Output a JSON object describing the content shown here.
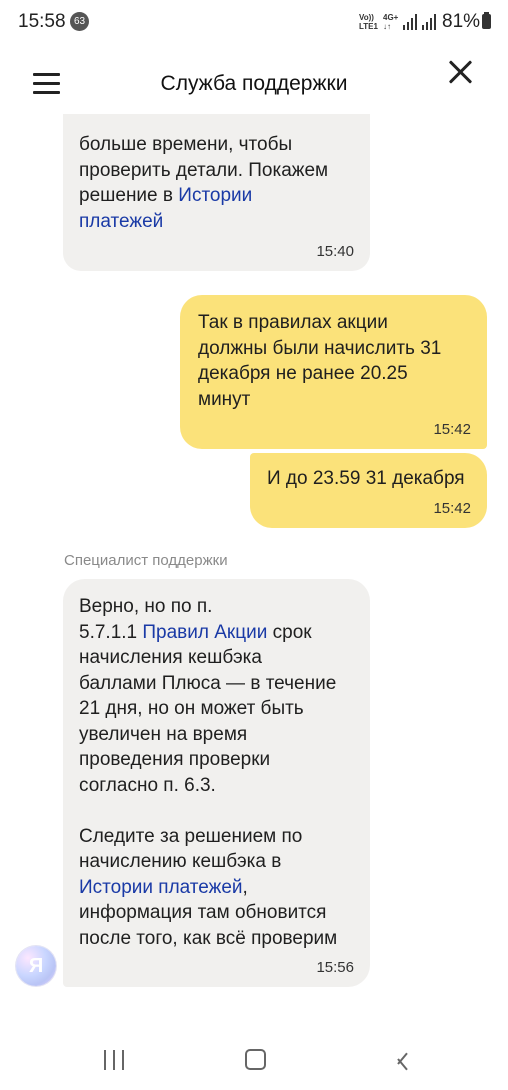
{
  "status_bar": {
    "time": "15:58",
    "notification_count": "63",
    "volte": "Vo))\nLTE1",
    "network": "4G+\n↓↑",
    "battery": "81%"
  },
  "header": {
    "title": "Служба поддержки",
    "menu_icon": "hamburger-menu-icon",
    "close_icon": "close-icon"
  },
  "messages": [
    {
      "author": "agent",
      "text_before": "больше времени, чтобы\nпроверить детали. Покажем\nрешение в ",
      "link": "Истории\nплатежей",
      "time": "15:40"
    },
    {
      "author": "user",
      "text": "Так в правилах акции\nдолжны были начислить 31\nдекабря не ранее 20.25\nминут",
      "time": "15:42"
    },
    {
      "author": "user",
      "text": "И до 23.59 31 декабря",
      "time": "15:42"
    },
    {
      "author": "agent",
      "sender_label": "Специалист поддержки",
      "text_1": "Верно, но по п.\n5.7.1.1 ",
      "link_1": "Правил Акции",
      "text_2": " срок\nначисления кешбэка\nбаллами Плюса — в течение\n21 дня, но он может быть\nувеличен на время\nпроведения проверки\nсогласно п. 6.3.\n\nСледите за решением по\nначислению кешбэка в\n",
      "link_2": "Истории платежей",
      "text_3": ",\nинформация там обновится\nпосле того, как всё проверим",
      "time": "15:56"
    }
  ],
  "avatar": {
    "letter": "Я"
  },
  "nav_bar": {
    "recent_icon": "recent-apps-icon",
    "home_icon": "home-icon",
    "back_icon": "back-icon"
  },
  "colors": {
    "user_bubble": "#fbe27a",
    "agent_bubble": "#f1f0ee",
    "link": "#1a3aa6"
  }
}
